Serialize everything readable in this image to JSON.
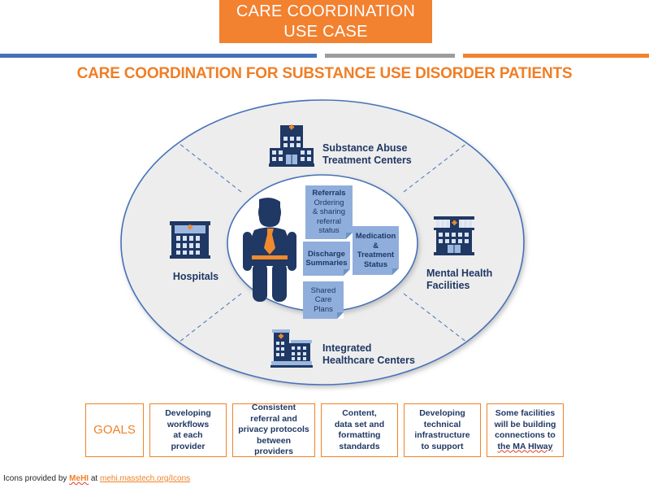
{
  "banner": {
    "line1": "CARE COORDINATION",
    "line2": "USE CASE",
    "background": "#F28130",
    "text_color": "#FFFFFF"
  },
  "divider": {
    "blue": "#4472B8",
    "gray": "#9C9C9C",
    "orange": "#F28130"
  },
  "subtitle": {
    "text": "CARE COORDINATION FOR SUBSTANCE USE DISORDER PATIENTS",
    "color": "#F07E26"
  },
  "diagram": {
    "outer_ellipse_fill": "#EDEDED",
    "outer_ellipse_stroke": "#4472B8",
    "inner_ellipse_fill": "#FFFFFF",
    "inner_ellipse_stroke": "#4472B8",
    "divider_style": "dashed",
    "nodes": [
      {
        "id": "substance",
        "icon": "hospital-building-icon",
        "label_line1": "Substance Abuse",
        "label_line2": "Treatment Centers",
        "position": "top"
      },
      {
        "id": "mental",
        "icon": "institution-building-icon",
        "label_line1": "Mental Health",
        "label_line2": "Facilities",
        "position": "right"
      },
      {
        "id": "integrated",
        "icon": "clinic-building-icon",
        "label_line1": "Integrated",
        "label_line2": "Healthcare Centers",
        "position": "bottom"
      },
      {
        "id": "hospitals",
        "icon": "hospital-tower-icon",
        "label_line1": "Hospitals",
        "label_line2": "",
        "position": "left"
      }
    ],
    "center": {
      "person_icon": "patient-person-icon",
      "cards": [
        {
          "id": "referrals",
          "lines": [
            "Referrals",
            "Ordering",
            "& sharing",
            "referral",
            "status"
          ],
          "bold_lines": [
            0
          ]
        },
        {
          "id": "discharge",
          "lines": [
            "Discharge",
            "Summaries"
          ],
          "bold_lines": [
            0,
            1
          ]
        },
        {
          "id": "medication",
          "lines": [
            "Medication",
            "&",
            "Treatment",
            "Status"
          ],
          "bold_lines": [
            0,
            1,
            2,
            3
          ]
        },
        {
          "id": "shared",
          "lines": [
            "Shared",
            "Care",
            "Plans"
          ],
          "bold_lines": []
        }
      ],
      "card_fill": "#8FAEDB",
      "card_text_color": "#1F3864"
    }
  },
  "goals": {
    "label": "GOALS",
    "label_color": "#F08228",
    "border_color": "#F08228",
    "items": [
      {
        "lines": [
          "Developing",
          "workflows",
          "at each",
          "provider"
        ]
      },
      {
        "lines": [
          "Consistent",
          "referral and",
          "privacy protocols",
          "between providers"
        ]
      },
      {
        "lines": [
          "Content,",
          "data set and",
          "formatting",
          "standards"
        ]
      },
      {
        "lines": [
          "Developing",
          "technical",
          "infrastructure",
          "to support"
        ]
      },
      {
        "lines": [
          "Some facilities",
          "will be building",
          "connections to",
          "the MA HIway"
        ],
        "spellcheck_word": "HIway"
      }
    ]
  },
  "footer": {
    "prefix": "Icons provided by ",
    "provider": "MeHI",
    "middle": " at ",
    "url": "mehi.masstech.org/Icons"
  }
}
